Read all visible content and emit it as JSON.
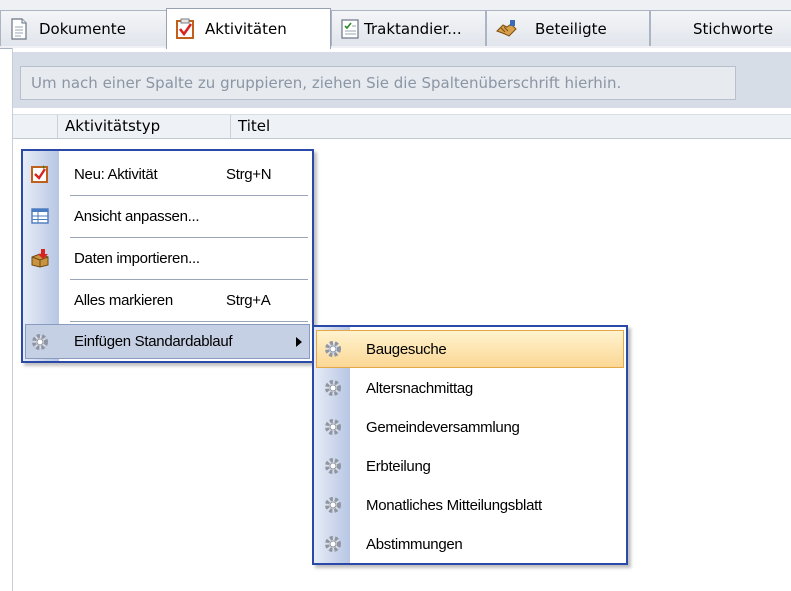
{
  "tabs": [
    {
      "label": "Dokumente",
      "icon": "document-icon"
    },
    {
      "label": "Aktivitäten",
      "icon": "activity-checkbox-icon"
    },
    {
      "label": "Traktandier...",
      "icon": "agenda-list-icon"
    },
    {
      "label": "Beteiligte",
      "icon": "handshake-icon"
    },
    {
      "label": "Stichworte",
      "icon": ""
    }
  ],
  "active_tab": "Aktivitäten",
  "grid": {
    "group_hint": "Um nach einer Spalte zu gruppieren, ziehen Sie die Spaltenüberschrift hierhin.",
    "columns": [
      "Aktivitätstyp",
      "Titel"
    ]
  },
  "context_menu": {
    "items": [
      {
        "label": "Neu: Aktivität",
        "shortcut": "Strg+N",
        "icon": "new-activity-icon"
      },
      {
        "label": "Ansicht anpassen...",
        "shortcut": "",
        "icon": "table-view-icon"
      },
      {
        "label": "Daten importieren...",
        "shortcut": "",
        "icon": "import-box-icon"
      },
      {
        "label": "Alles markieren",
        "shortcut": "Strg+A",
        "icon": ""
      },
      {
        "label": "Einfügen Standardablauf",
        "shortcut": "",
        "icon": "gear-icon",
        "has_submenu": true
      }
    ]
  },
  "submenu": {
    "items": [
      {
        "label": "Baugesuche",
        "icon": "gear-icon"
      },
      {
        "label": "Altersnachmittag",
        "icon": "gear-icon"
      },
      {
        "label": "Gemeindeversammlung",
        "icon": "gear-icon"
      },
      {
        "label": "Erbteilung",
        "icon": "gear-icon"
      },
      {
        "label": "Monatliches Mitteilungsblatt",
        "icon": "gear-icon"
      },
      {
        "label": "Abstimmungen",
        "icon": "gear-icon"
      }
    ],
    "highlighted": "Baugesuche"
  },
  "colors": {
    "menu_border": "#2a49a9",
    "highlight_border": "#e6a748",
    "highlight_fill": "#fbd794",
    "group_hint_text": "#8b95a3"
  }
}
